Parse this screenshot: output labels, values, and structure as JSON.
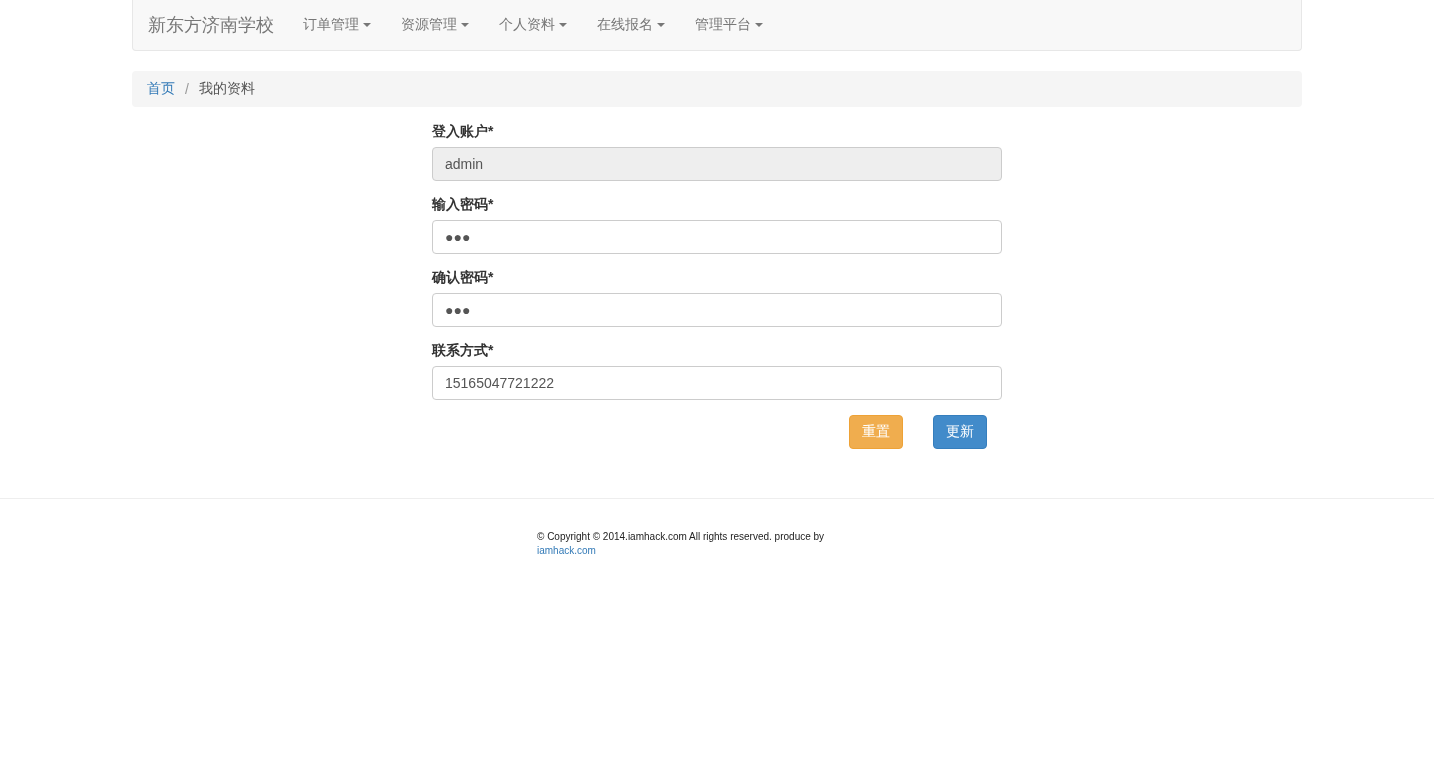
{
  "navbar": {
    "brand": "新东方济南学校",
    "menus": [
      {
        "label": "订单管理"
      },
      {
        "label": "资源管理"
      },
      {
        "label": "个人资料"
      },
      {
        "label": "在线报名"
      },
      {
        "label": "管理平台"
      }
    ]
  },
  "breadcrumb_separator": "/",
  "breadcrumb": [
    {
      "label": "首页",
      "kind": "link"
    },
    {
      "label": "我的资料",
      "kind": "current"
    }
  ],
  "form": {
    "fields": [
      {
        "label": "登入账户*",
        "value": "admin",
        "disabled": true
      },
      {
        "label": "输入密码*",
        "value": "●●●",
        "disabled": false
      },
      {
        "label": "确认密码*",
        "value": "●●●",
        "disabled": false
      },
      {
        "label": "联系方式*",
        "value": "15165047721222",
        "disabled": false
      }
    ],
    "buttons": [
      {
        "label": "重置",
        "kind": "warning"
      },
      {
        "label": "更新",
        "kind": "primary"
      }
    ]
  },
  "footer": {
    "text": "© Copyright © 2014.iamhack.com All rights reserved. produce by",
    "link": "iamhack.com"
  }
}
